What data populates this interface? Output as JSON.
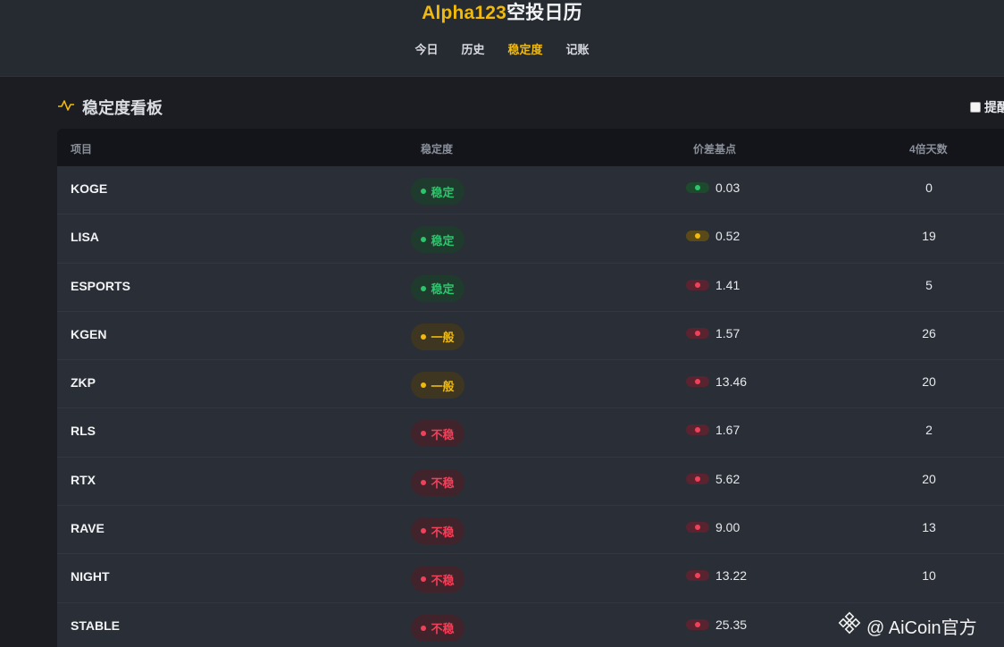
{
  "header": {
    "brand_part1": "Alpha123",
    "brand_part2": "空投日历",
    "nav": [
      {
        "label": "今日",
        "active": false
      },
      {
        "label": "历史",
        "active": false
      },
      {
        "label": "稳定度",
        "active": true
      },
      {
        "label": "记账",
        "active": false
      }
    ]
  },
  "panel": {
    "title": "稳定度看板",
    "title_icon": "pulse-icon",
    "remind_label": "提醒"
  },
  "table": {
    "columns": [
      "项目",
      "稳定度",
      "价差基点",
      "4倍天数"
    ],
    "rows": [
      {
        "name": "KOGE",
        "stability": "稳定",
        "level": "stable",
        "spread": "0.03",
        "spread_level": "green",
        "days": "0"
      },
      {
        "name": "LISA",
        "stability": "稳定",
        "level": "stable",
        "spread": "0.52",
        "spread_level": "yellow",
        "days": "19"
      },
      {
        "name": "ESPORTS",
        "stability": "稳定",
        "level": "stable",
        "spread": "1.41",
        "spread_level": "red",
        "days": "5"
      },
      {
        "name": "KGEN",
        "stability": "一般",
        "level": "normal",
        "spread": "1.57",
        "spread_level": "red",
        "days": "26"
      },
      {
        "name": "ZKP",
        "stability": "一般",
        "level": "normal",
        "spread": "13.46",
        "spread_level": "red",
        "days": "20"
      },
      {
        "name": "RLS",
        "stability": "不稳",
        "level": "unstable",
        "spread": "1.67",
        "spread_level": "red",
        "days": "2"
      },
      {
        "name": "RTX",
        "stability": "不稳",
        "level": "unstable",
        "spread": "5.62",
        "spread_level": "red",
        "days": "20"
      },
      {
        "name": "RAVE",
        "stability": "不稳",
        "level": "unstable",
        "spread": "9.00",
        "spread_level": "red",
        "days": "13"
      },
      {
        "name": "NIGHT",
        "stability": "不稳",
        "level": "unstable",
        "spread": "13.22",
        "spread_level": "red",
        "days": "10"
      },
      {
        "name": "STABLE",
        "stability": "不稳",
        "level": "unstable",
        "spread": "25.35",
        "spread_level": "red",
        "days": ""
      }
    ]
  },
  "watermark": {
    "text": "@ AiCoin官方",
    "icon": "binance-logo-icon"
  },
  "colors": {
    "accent": "#f0b90b",
    "stable": "#2ec46c",
    "unstable": "#f0415a",
    "background": "#1b1d22"
  }
}
